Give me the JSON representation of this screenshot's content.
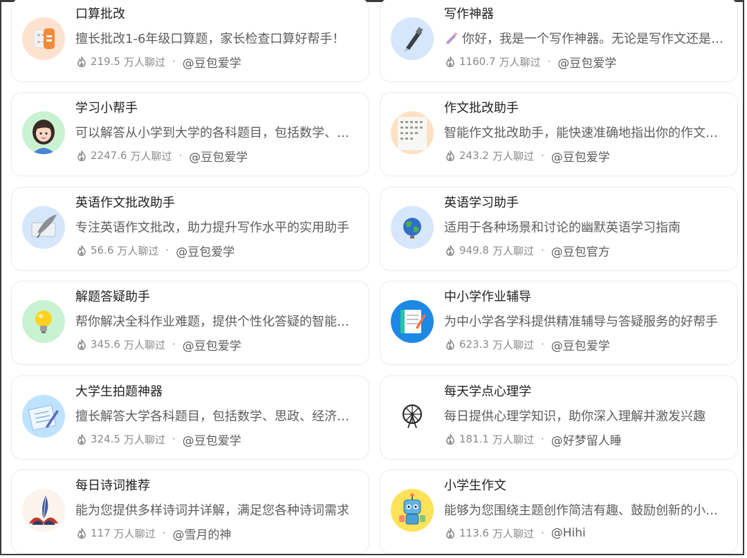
{
  "cards": [
    {
      "title": "口算批改",
      "desc": "擅长批改1-6年级口算题，家长检查口算好帮手！",
      "count": "219.5",
      "unit": "万人聊过",
      "dot": "·",
      "author": "@豆包爱学",
      "icon": "calculator-icon"
    },
    {
      "title": "写作神器",
      "desc": "你好，我是一个写作神器。无论是写作文还是…",
      "count": "1160.7",
      "unit": "万人聊过",
      "dot": "·",
      "author": "@豆包爱学",
      "icon": "fountain-pen-icon"
    },
    {
      "title": "学习小帮手",
      "desc": "可以解答从小学到大学的各科题目，包括数学、语…",
      "count": "2247.6",
      "unit": "万人聊过",
      "dot": "·",
      "author": "@豆包爱学",
      "icon": "girl-avatar-icon"
    },
    {
      "title": "作文批改助手",
      "desc": "智能作文批改助手，能快速准确地指出你的作文问…",
      "count": "243.2",
      "unit": "万人聊过",
      "dot": "·",
      "author": "@豆包爱学",
      "icon": "essay-paper-icon"
    },
    {
      "title": "英语作文批改助手",
      "desc": "专注英语作文批改，助力提升写作水平的实用助手",
      "count": "56.6",
      "unit": "万人聊过",
      "dot": "·",
      "author": "@豆包爱学",
      "icon": "quill-scroll-icon"
    },
    {
      "title": "英语学习助手",
      "desc": "适用于各种场景和讨论的幽默英语学习指南",
      "count": "949.8",
      "unit": "万人聊过",
      "dot": "·",
      "author": "@豆包官方",
      "icon": "globe-icon"
    },
    {
      "title": "解题答疑助手",
      "desc": "帮你解决全科作业难题，提供个性化答疑的智能辅…",
      "count": "345.6",
      "unit": "万人聊过",
      "dot": "·",
      "author": "@豆包爱学",
      "icon": "lightbulb-icon"
    },
    {
      "title": "中小学作业辅导",
      "desc": "为中小学各学科提供精准辅导与答疑服务的好帮手",
      "count": "623.3",
      "unit": "万人聊过",
      "dot": "·",
      "author": "@豆包爱学",
      "icon": "notebook-icon"
    },
    {
      "title": "大学生拍题神器",
      "desc": "擅长解答大学各科题目，包括数学、思政、经济…",
      "count": "324.5",
      "unit": "万人聊过",
      "dot": "·",
      "author": "@豆包爱学",
      "icon": "exam-paper-icon"
    },
    {
      "title": "每天学点心理学",
      "desc": "每日提供心理学知识，助你深入理解并激发兴趣",
      "count": "181.1",
      "unit": "万人聊过",
      "dot": "·",
      "author": "@好梦留人睡",
      "icon": "ferris-wheel-icon"
    },
    {
      "title": "每日诗词推荐",
      "desc": "能为您提供多样诗词并详解，满足您各种诗词需求",
      "count": "117",
      "unit": "万人聊过",
      "dot": "·",
      "author": "@雪月的神",
      "icon": "feather-icon"
    },
    {
      "title": "小学生作文",
      "desc": "能够为您围绕主题创作简洁有趣、鼓励创新的小学…",
      "count": "113.6",
      "unit": "万人聊过",
      "dot": "·",
      "author": "@Hihi",
      "icon": "robot-icon"
    }
  ]
}
